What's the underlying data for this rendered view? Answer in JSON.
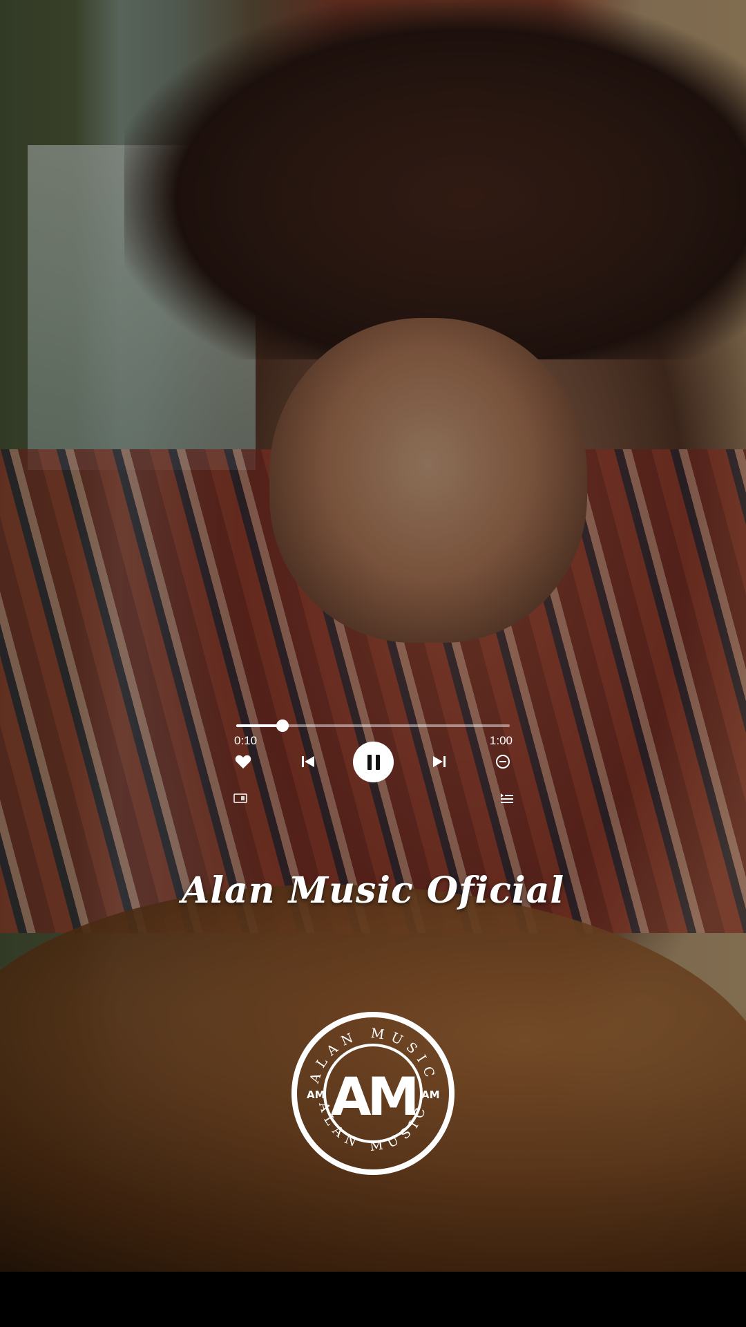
{
  "player": {
    "progress_fraction": 0.17,
    "time_elapsed": "0:10",
    "time_total": "1:00",
    "state": "playing"
  },
  "icons": {
    "like": "heart-icon",
    "previous": "skip-previous-icon",
    "play_pause": "pause-icon",
    "next": "skip-next-icon",
    "remove": "minus-circle-icon",
    "cast": "cast-icon",
    "queue": "queue-list-icon"
  },
  "overlay": {
    "channel_name": "Alan Music Oficial"
  },
  "logo": {
    "monogram": "AM",
    "ring_text_top": "ALAN MUSIC",
    "ring_text_bottom": "ALAN MUSIC",
    "side_mark": "AM"
  },
  "colors": {
    "foreground": "#ffffff",
    "play_button_bg": "#ffffff",
    "play_button_icon": "#111111"
  }
}
